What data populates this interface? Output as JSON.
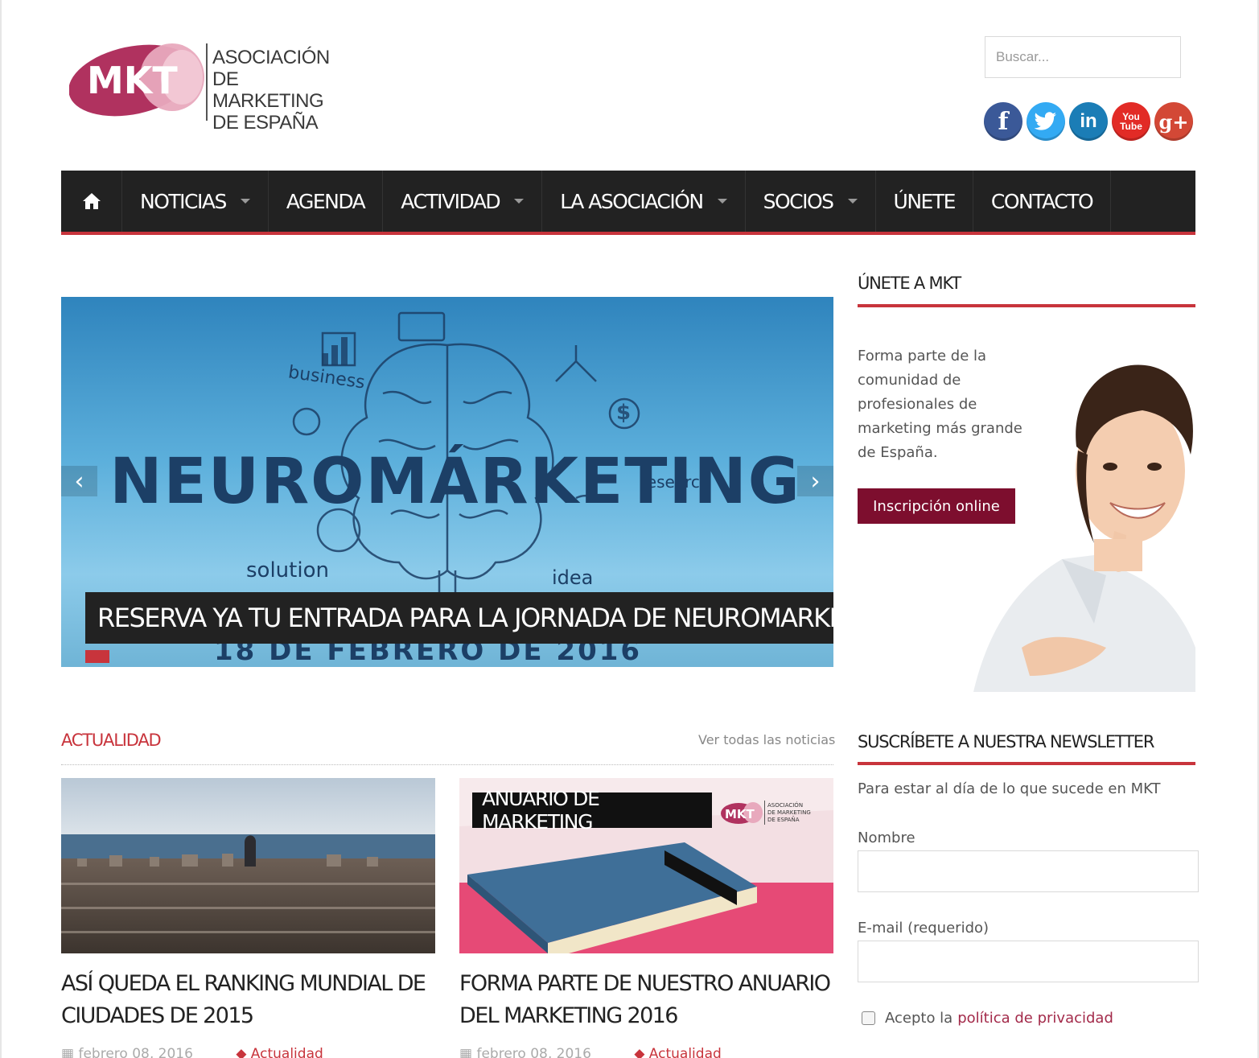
{
  "header": {
    "logo": {
      "mark": "MKT",
      "line1": "ASOCIACIÓN",
      "line2": "DE MARKETING",
      "line3": "DE ESPAÑA"
    },
    "search": {
      "placeholder": "Buscar..."
    },
    "socials": [
      {
        "name": "facebook",
        "glyph": "f",
        "color": "#3b5998"
      },
      {
        "name": "twitter",
        "glyph": "t",
        "color": "#33aaf3"
      },
      {
        "name": "linkedin",
        "glyph": "in",
        "color": "#1b7db6"
      },
      {
        "name": "youtube",
        "glyph": "You Tube",
        "color": "#e22b26"
      },
      {
        "name": "google-plus",
        "glyph": "g+",
        "color": "#d34836"
      }
    ]
  },
  "nav": {
    "home_icon": "home-icon",
    "items": [
      {
        "label": "NOTICIAS",
        "dropdown": true
      },
      {
        "label": "AGENDA",
        "dropdown": false
      },
      {
        "label": "ACTIVIDAD",
        "dropdown": true
      },
      {
        "label": "LA ASOCIACIÓN",
        "dropdown": true
      },
      {
        "label": "SOCIOS",
        "dropdown": true
      },
      {
        "label": "ÚNETE",
        "dropdown": false
      },
      {
        "label": "CONTACTO",
        "dropdown": false
      }
    ]
  },
  "slider": {
    "image_word": "NEUROMÁRKETING",
    "image_date": "18 DE FEBRERO DE 2016",
    "image_labels": {
      "business": "business",
      "solution": "solution",
      "idea": "idea",
      "research": "research"
    },
    "caption": "RESERVA YA TU ENTRADA PARA LA JORNADA DE NEUROMARKETING",
    "prev_icon": "chevron-left-icon",
    "next_icon": "chevron-right-icon"
  },
  "sidebar": {
    "join": {
      "title": "ÚNETE A MKT",
      "text": "Forma parte de la comunidad de profesionales de marketing más grande de España.",
      "button": "Inscripción online"
    },
    "newsletter": {
      "title": "SUSCRÍBETE A NUESTRA NEWSLETTER",
      "intro": "Para estar al día de lo que sucede en MKT",
      "name_label": "Nombre",
      "email_label": "E-mail (requerido)",
      "consent_prefix": "Acepto la",
      "consent_link": "política de privacidad"
    }
  },
  "news": {
    "section_title": "ACTUALIDAD",
    "see_all": "Ver todas las noticias",
    "cards": [
      {
        "title": "ASÍ QUEDA EL RANKING MUNDIAL DE CIUDADES DE 2015",
        "date": "febrero 08, 2016",
        "category": "Actualidad"
      },
      {
        "title": "FORMA PARTE DE NUESTRO ANUARIO DEL MARKETING 2016",
        "date": "febrero 08, 2016",
        "category": "Actualidad",
        "banner": "ANUARIO DE MARKETING",
        "banner_logo": {
          "mark": "MKT",
          "line1": "ASOCIACIÓN",
          "line2": "DE MARKETING",
          "line3": "DE ESPAÑA"
        }
      }
    ]
  },
  "colors": {
    "accent": "#c8343c",
    "nav_bg": "#222222",
    "button_bg": "#7d0e2e",
    "logo_magenta": "#b0325f",
    "logo_pink": "#e8a9bd"
  }
}
